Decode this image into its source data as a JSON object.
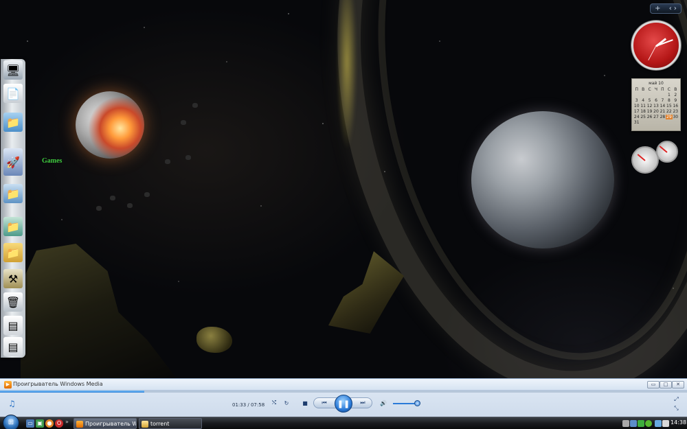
{
  "desktop": {
    "dock_label": "Games",
    "dock_items": [
      {
        "name": "computer",
        "icon": "computer-icon"
      },
      {
        "name": "documents",
        "icon": "document-icon"
      },
      {
        "name": "folder",
        "icon": "folder-icon"
      },
      {
        "name": "games",
        "icon": "rocket-icon"
      },
      {
        "name": "pictures-folder",
        "icon": "folder-icon"
      },
      {
        "name": "network-folder",
        "icon": "folder-icon"
      },
      {
        "name": "yellow-folder",
        "icon": "folder-icon"
      },
      {
        "name": "tools",
        "icon": "tools-icon"
      },
      {
        "name": "recycle-bin",
        "icon": "recycle-bin-icon"
      },
      {
        "name": "window-1",
        "icon": "window-icon"
      },
      {
        "name": "window-2",
        "icon": "window-icon"
      }
    ]
  },
  "gadgets": {
    "toolbar": {
      "add": "+",
      "nav": "‹ ›"
    },
    "calendar": {
      "month_label": "май 10",
      "weekdays": [
        "П",
        "В",
        "С",
        "Ч",
        "П",
        "С",
        "В"
      ],
      "days": [
        "",
        "",
        "",
        "",
        "",
        "1",
        "2",
        "3",
        "4",
        "5",
        "6",
        "7",
        "8",
        "9",
        "10",
        "11",
        "12",
        "13",
        "14",
        "15",
        "16",
        "17",
        "18",
        "19",
        "20",
        "21",
        "22",
        "23",
        "24",
        "25",
        "26",
        "27",
        "28",
        "29",
        "30",
        "31"
      ],
      "today": "29"
    }
  },
  "media_player": {
    "title": "Проигрыватель Windows Media",
    "time": "01:33 / 07:58",
    "progress": 0.21,
    "volume": 0.9,
    "buttons": {
      "minimize": "▭",
      "maximize": "□",
      "close": "✕",
      "play_pause": "❚❚",
      "stop": "■",
      "prev": "⏮",
      "next": "⏭",
      "shuffle": "⤭",
      "repeat": "↻",
      "volume": "🔊",
      "switch_to_library": "⤢",
      "switch_to_skin": "⤡"
    }
  },
  "taskbar": {
    "start": "⊞",
    "quick_more": "»",
    "tasks": [
      {
        "label": "Проигрыватель Wi...",
        "active": true
      },
      {
        "label": "torrent",
        "active": false
      }
    ],
    "clock": "14:38"
  }
}
